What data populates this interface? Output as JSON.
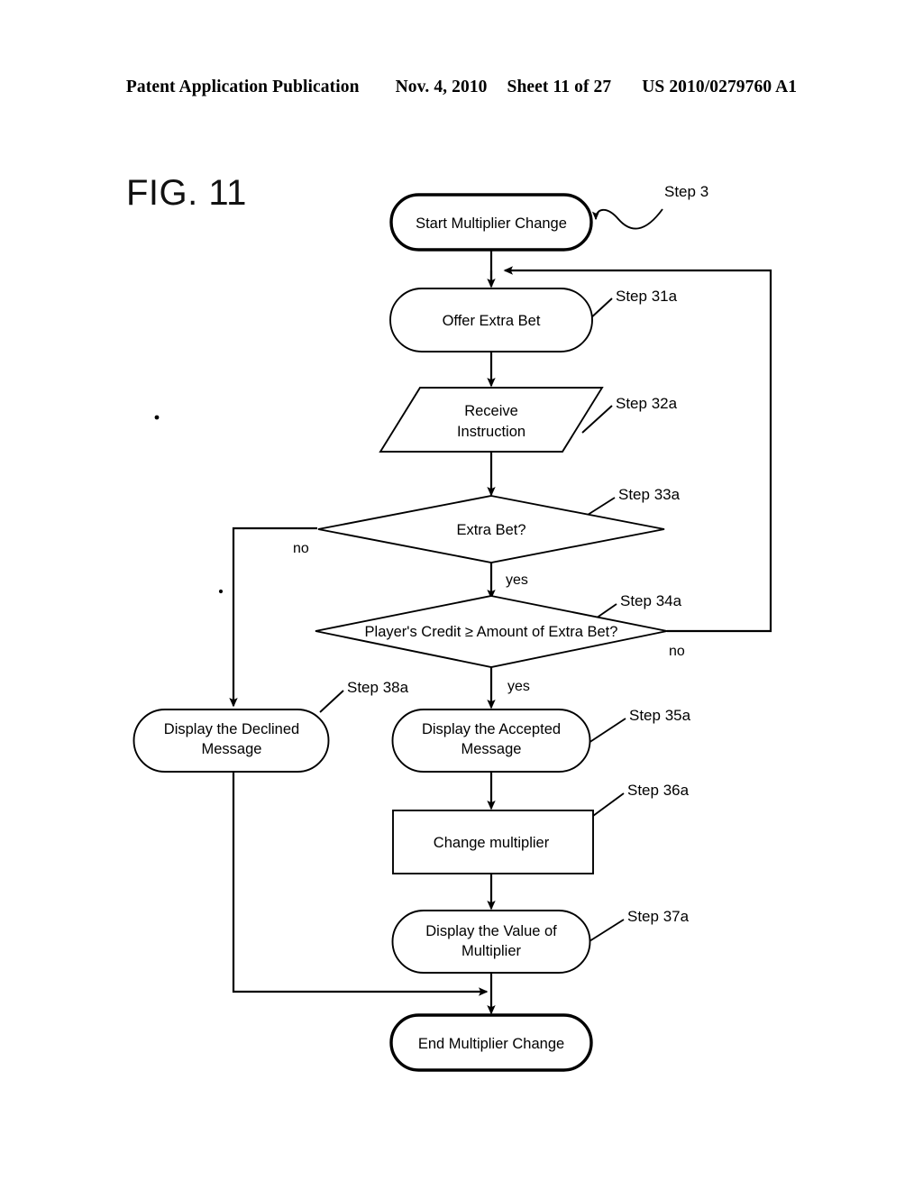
{
  "header": {
    "publication": "Patent Application Publication",
    "date": "Nov. 4, 2010",
    "sheet": "Sheet 11 of 27",
    "number": "US 2010/0279760 A1"
  },
  "figure": {
    "label": "FIG. 11"
  },
  "diagram": {
    "type": "flowchart",
    "nodes": [
      {
        "id": "start",
        "shape": "terminator",
        "label": "Start Multiplier Change",
        "step": "Step 3"
      },
      {
        "id": "offer",
        "shape": "stadium",
        "label": "Offer Extra Bet",
        "step": "Step 31a"
      },
      {
        "id": "receive",
        "shape": "parallelogram",
        "label_line1": "Receive",
        "label_line2": "Instruction",
        "step": "Step 32a"
      },
      {
        "id": "extrabet",
        "shape": "decision",
        "label": "Extra Bet?",
        "step": "Step 33a"
      },
      {
        "id": "credit",
        "shape": "decision",
        "label": "Player's Credit ≥ Amount of Extra Bet?",
        "step": "Step 34a"
      },
      {
        "id": "declined",
        "shape": "stadium",
        "label_line1": "Display the Declined",
        "label_line2": "Message",
        "step": "Step 38a"
      },
      {
        "id": "accepted",
        "shape": "stadium",
        "label_line1": "Display the Accepted",
        "label_line2": "Message",
        "step": "Step 35a"
      },
      {
        "id": "change",
        "shape": "rectangle",
        "label": "Change multiplier",
        "step": "Step 36a"
      },
      {
        "id": "value",
        "shape": "stadium",
        "label_line1": "Display the Value of",
        "label_line2": "Multiplier",
        "step": "Step 37a"
      },
      {
        "id": "end",
        "shape": "terminator",
        "label": "End Multiplier Change",
        "step": ""
      }
    ],
    "branch_labels": {
      "extrabet_no": "no",
      "extrabet_yes": "yes",
      "credit_no": "no",
      "credit_yes": "yes"
    }
  }
}
